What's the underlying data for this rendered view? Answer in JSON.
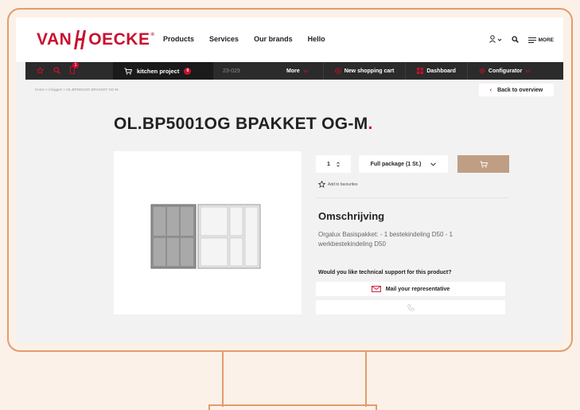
{
  "brand": {
    "name_left": "VAN",
    "name_right": "OECKE",
    "reg": "®",
    "red": "#c8102e",
    "accent_orange": "#e39b6e"
  },
  "nav": {
    "items": [
      "Products",
      "Services",
      "Our brands",
      "Hello"
    ]
  },
  "header_icons": {
    "user": "user-icon",
    "search": "search-icon",
    "menu_label": "MORE"
  },
  "darkbar": {
    "cart_count": "1",
    "project_label": "kitchen project",
    "project_count": "0",
    "reference": "23-029",
    "more_label": "More",
    "new_cart_label": "New shopping cart",
    "dashboard_label": "Dashboard",
    "configurator_label": "Configurator"
  },
  "breadcrumb": "Home > inloggen > OL.BP5001OG BPAKKET OG-M",
  "back_label": "Back to overview",
  "product": {
    "title": "OL.BP5001OG BPAKKET OG-M",
    "title_dot": ".",
    "quantity": "1",
    "package_option": "Full package (1 St.)",
    "favourites_label": "Add to favourites",
    "description_heading": "Omschrijving",
    "description_text": "Orgalux Basispakket: - 1 bestekindeling D50 - 1 werkbestekindeling D50",
    "support_question": "Would you like technical support for this product?",
    "mail_label": "Mail your representative"
  }
}
